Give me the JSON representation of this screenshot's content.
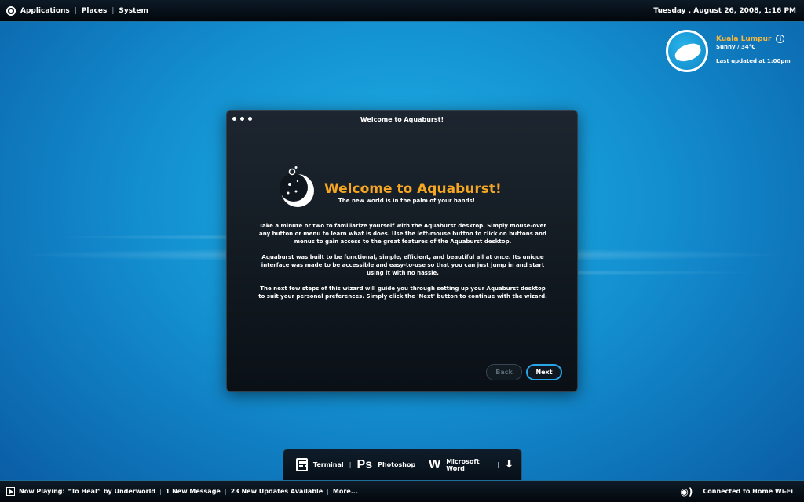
{
  "top_panel": {
    "menus": [
      "Applications",
      "Places",
      "System"
    ],
    "clock": "Tuesday , August 26, 2008, 1:16 PM"
  },
  "weather": {
    "city": "Kuala Lumpur",
    "condition": "Sunny / 34°C",
    "updated": "Last updated at 1:00pm"
  },
  "dialog": {
    "window_title": "Welcome to Aquaburst!",
    "heading": "Welcome to Aquaburst!",
    "subheading": "The new world is in the palm of your hands!",
    "paragraphs": [
      "Take a minute or two to familiarize yourself with the Aquaburst desktop. Simply mouse-over any button or menu to learn what is does. Use the left-mouse button to click on buttons and menus to gain access to the great features of the Aquaburst desktop.",
      "Aquaburst was built to be functional, simple, efficient, and beautiful all at once. Its unique interface was made to be accessible and easy-to-use so that you can just jump in and start using it with no hassle.",
      "The next few steps of this wizard will guide you through setting up your Aquaburst desktop to suit your personal preferences. Simply click the 'Next' button to continue with the wizard."
    ],
    "back_label": "Back",
    "next_label": "Next"
  },
  "dock": {
    "items": [
      {
        "icon": "terminal-icon",
        "glyph": "",
        "label": "Terminal"
      },
      {
        "icon": "photoshop-icon",
        "glyph": "Ps",
        "label": "Photoshop"
      },
      {
        "icon": "word-icon",
        "glyph": "W",
        "label": "Microsoft Word"
      }
    ],
    "more_glyph": "⬇"
  },
  "bottom_panel": {
    "now_playing": "Now Playing:  “To Heal” by Underworld",
    "messages": "1 New Message",
    "updates": "23 New Updates Available",
    "more": "More...",
    "network": "Connected to Home Wi-Fi"
  },
  "colors": {
    "accent": "#f5a623",
    "button_ring": "#2aa6ea"
  }
}
